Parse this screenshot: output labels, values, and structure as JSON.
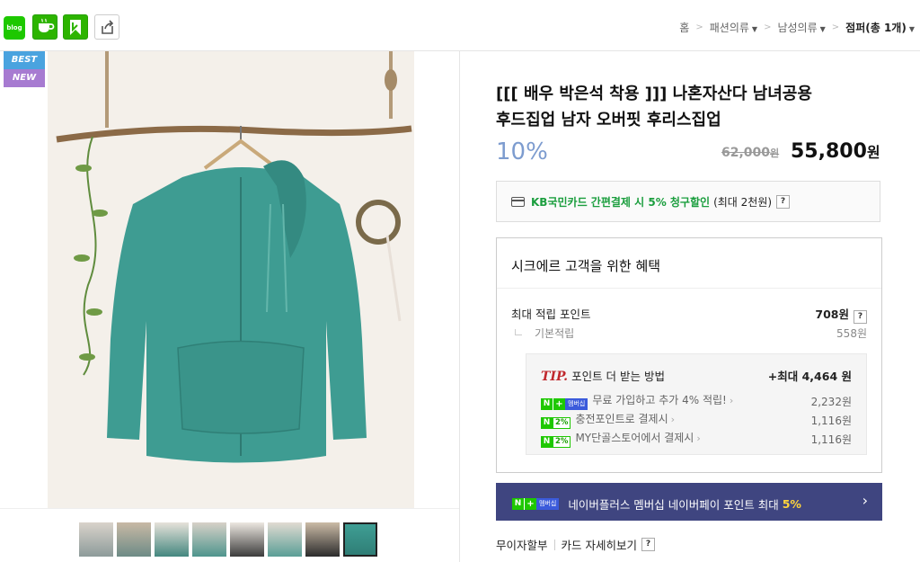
{
  "topbar": {
    "icons": {
      "blog_label": "blog",
      "cafe": "cafe-icon",
      "band": "bookmark-icon",
      "share": "share-icon"
    },
    "breadcrumb": {
      "home": "홈",
      "cat1": "패션의류",
      "cat2": "남성의류",
      "current": "점퍼(총 1개)"
    }
  },
  "gallery": {
    "badge_best": "BEST",
    "badge_new": "NEW",
    "thumb_count": 8,
    "selected_thumb": 8
  },
  "product": {
    "title_line1": "[[[ 배우 박은석 착용 ]]] 나혼자산다 남녀공용",
    "title_line2": "후드집업 남자 오버핏 후리스집업",
    "discount": "10%",
    "original_price": "62,000",
    "original_unit": "원",
    "sale_price": "55,800",
    "sale_unit": "원"
  },
  "card_promo": {
    "highlight": "KB국민카드 간편결제 시 5% 청구할인",
    "note": "(최대 2천원)",
    "help": "?"
  },
  "benefit": {
    "title": "시크에르 고객을 위한 혜택",
    "max_label": "최대 적립 포인트",
    "max_value": "708원",
    "help": "?",
    "base_label": "기본적립",
    "base_value": "558원",
    "tip": {
      "tip_word": "TIP.",
      "heading": "포인트 더 받는 방법",
      "total": "+최대 4,464 원",
      "rows": [
        {
          "badge": "멤버십",
          "label": "무료 가입하고 추가 4% 적립!",
          "value": "2,232원"
        },
        {
          "badge": "2%",
          "label": "충전포인트로 결제시",
          "value": "1,116원"
        },
        {
          "badge": "2%",
          "label": "MY단골스토어에서 결제시",
          "value": "1,116원"
        }
      ]
    }
  },
  "naver_bar": {
    "badge": "멤버십",
    "text": "네이버플러스 멤버십 네이버페이 포인트 최대",
    "highlight": "5%"
  },
  "installment": {
    "free": "무이자할부",
    "detail": "카드 자세히보기",
    "help": "?"
  },
  "colors": {
    "discount_blue": "#7d9ccf",
    "naver_green": "#1ec800",
    "navbar": "#3f4580",
    "tip_red": "#c0282d",
    "best_badge": "#4aa3df",
    "new_badge": "#a77bd1"
  }
}
